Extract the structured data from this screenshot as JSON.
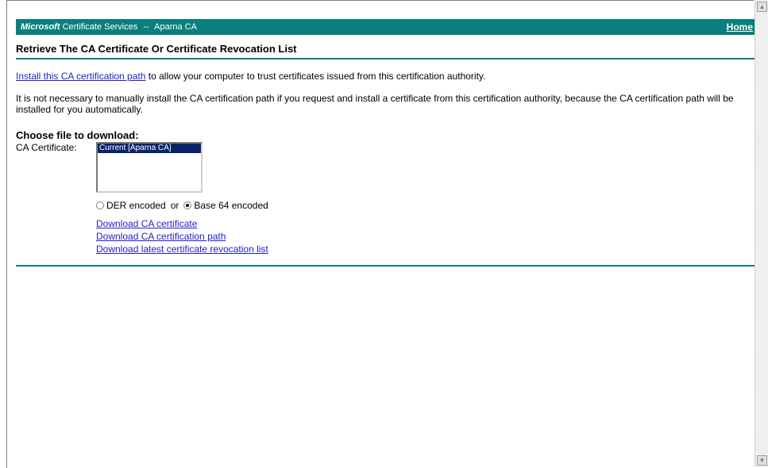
{
  "banner": {
    "brand": "Microsoft",
    "service": "Certificate Services",
    "separator": "--",
    "ca_name": "Aparna CA",
    "home_label": "Home"
  },
  "page": {
    "title": "Retrieve The CA Certificate Or Certificate Revocation List",
    "install_link": "Install this CA certification path",
    "install_text": " to allow your computer to trust certificates issued from this certification authority.",
    "note": "It is not necessary to manually install the CA certification path if you request and install a certificate from this certification authority, because the CA certification path will be installed for you automatically."
  },
  "download": {
    "heading": "Choose file to download:",
    "ca_label": "CA Certificate:",
    "list_options": [
      "Current [Aparna CA]"
    ],
    "encoding": {
      "der_label": "DER encoded",
      "or_label": "or",
      "base64_label": "Base 64 encoded",
      "selected": "base64"
    },
    "links": [
      "Download CA certificate",
      "Download CA certification path",
      "Download latest certificate revocation list"
    ]
  },
  "colors": {
    "banner": "#0a7f7d",
    "link": "#2020cc",
    "selection": "#0a246a"
  }
}
